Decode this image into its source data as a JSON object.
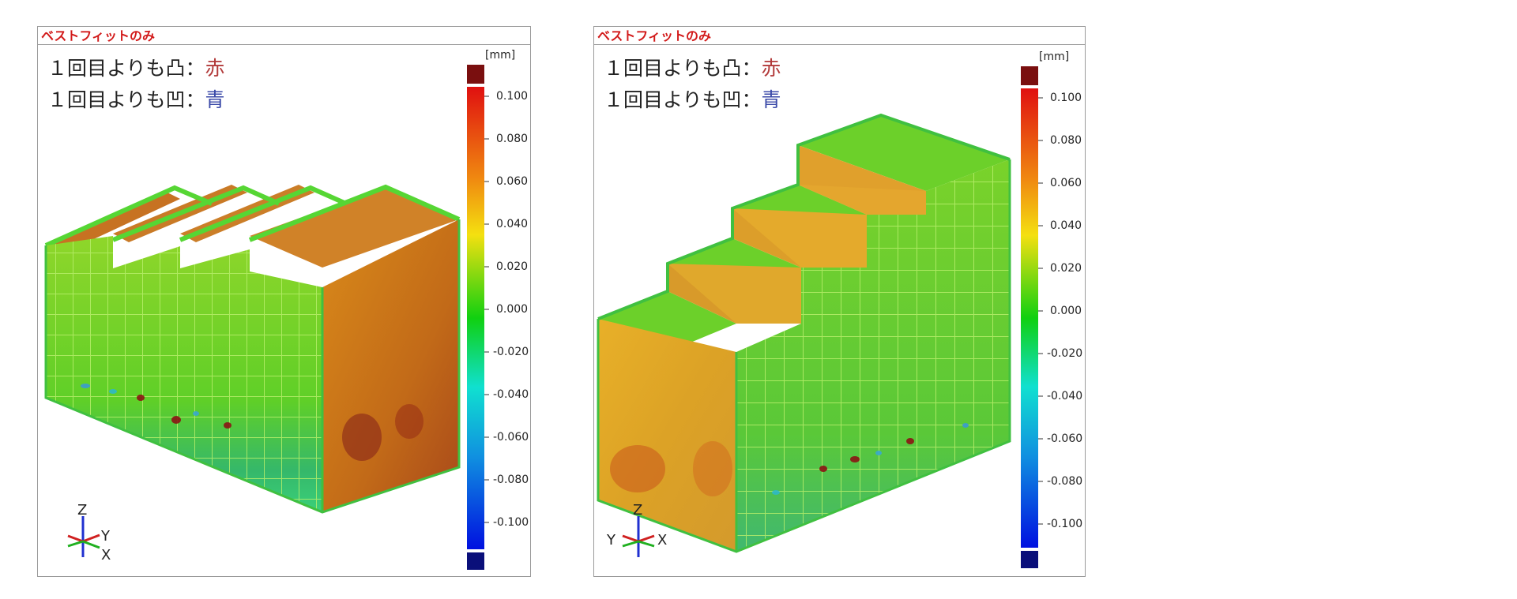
{
  "panels": [
    {
      "title": "ベストフィットのみ",
      "unit": "[mm]",
      "legend": [
        {
          "prefix": "１回目よりも凸：",
          "color_word": "赤"
        },
        {
          "prefix": "１回目よりも凹：",
          "color_word": "青"
        }
      ],
      "ticks": [
        "0.100",
        "0.080",
        "0.060",
        "0.040",
        "0.020",
        "0.000",
        "-0.020",
        "-0.040",
        "-0.060",
        "-0.080",
        "-0.100"
      ],
      "axes": {
        "z": "Z",
        "y": "Y",
        "x": "X"
      }
    },
    {
      "title": "ベストフィットのみ",
      "unit": "[mm]",
      "legend": [
        {
          "prefix": "１回目よりも凸：",
          "color_word": "赤"
        },
        {
          "prefix": "１回目よりも凹：",
          "color_word": "青"
        }
      ],
      "ticks": [
        "0.100",
        "0.080",
        "0.060",
        "0.040",
        "0.020",
        "0.000",
        "-0.020",
        "-0.040",
        "-0.060",
        "-0.080",
        "-0.100"
      ],
      "axes": {
        "z": "Z",
        "y": "Y",
        "x": "X"
      }
    }
  ],
  "colors": {
    "over_range": "#7a0f0f",
    "under_range": "#0a0f7a",
    "scale_top": "#e01010",
    "scale_mid": "#10d010",
    "scale_bottom": "#0010e0"
  }
}
